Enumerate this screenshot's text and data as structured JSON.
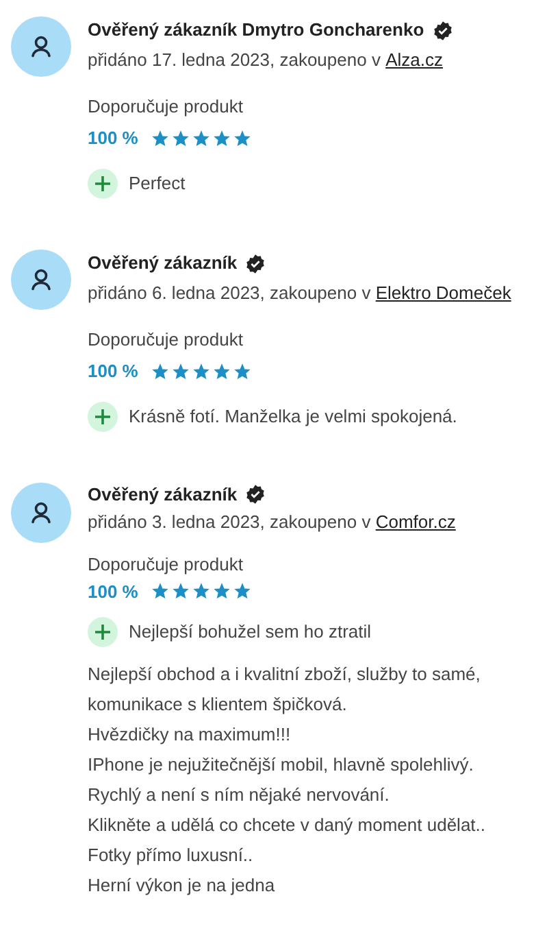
{
  "reviews": [
    {
      "author": "Ověřený zákazník Dmytro Goncharenko",
      "verified": true,
      "added": "přidáno 17. ledna 2023, zakoupeno v ",
      "shop": "Alza.cz",
      "recommend": "Doporučuje produkt",
      "percent": "100 %",
      "stars": 5,
      "pros": [
        "Perfect"
      ]
    },
    {
      "author": "Ověřený zákazník",
      "verified": true,
      "added": "přidáno 6. ledna 2023, zakoupeno v ",
      "shop": "Elektro Domeček",
      "recommend": "Doporučuje produkt",
      "percent": "100 %",
      "stars": 5,
      "pros": [
        "Krásně fotí. Manželka je velmi spokojená."
      ]
    },
    {
      "author": "Ověřený zákazník",
      "verified": true,
      "added": "přidáno 3. ledna 2023, zakoupeno v ",
      "shop": "Comfor.cz",
      "recommend": "Doporučuje produkt",
      "percent": "100 %",
      "stars": 5,
      "pros": [
        "Nejlepší bohužel sem ho ztratil"
      ],
      "body": [
        "Nejlepší obchod a i kvalitní zboží, služby to samé,",
        "komunikace s klientem špičková.",
        "Hvězdičky na maximum!!!",
        "IPhone je nejužitečnější mobil, hlavně spolehlivý.",
        "Rychlý a není s ním nějaké nervování.",
        "Klikněte a udělá co chcete v daný moment udělat..",
        "Fotky přímo luxusní..",
        "Herní výkon je na jedna"
      ]
    }
  ]
}
